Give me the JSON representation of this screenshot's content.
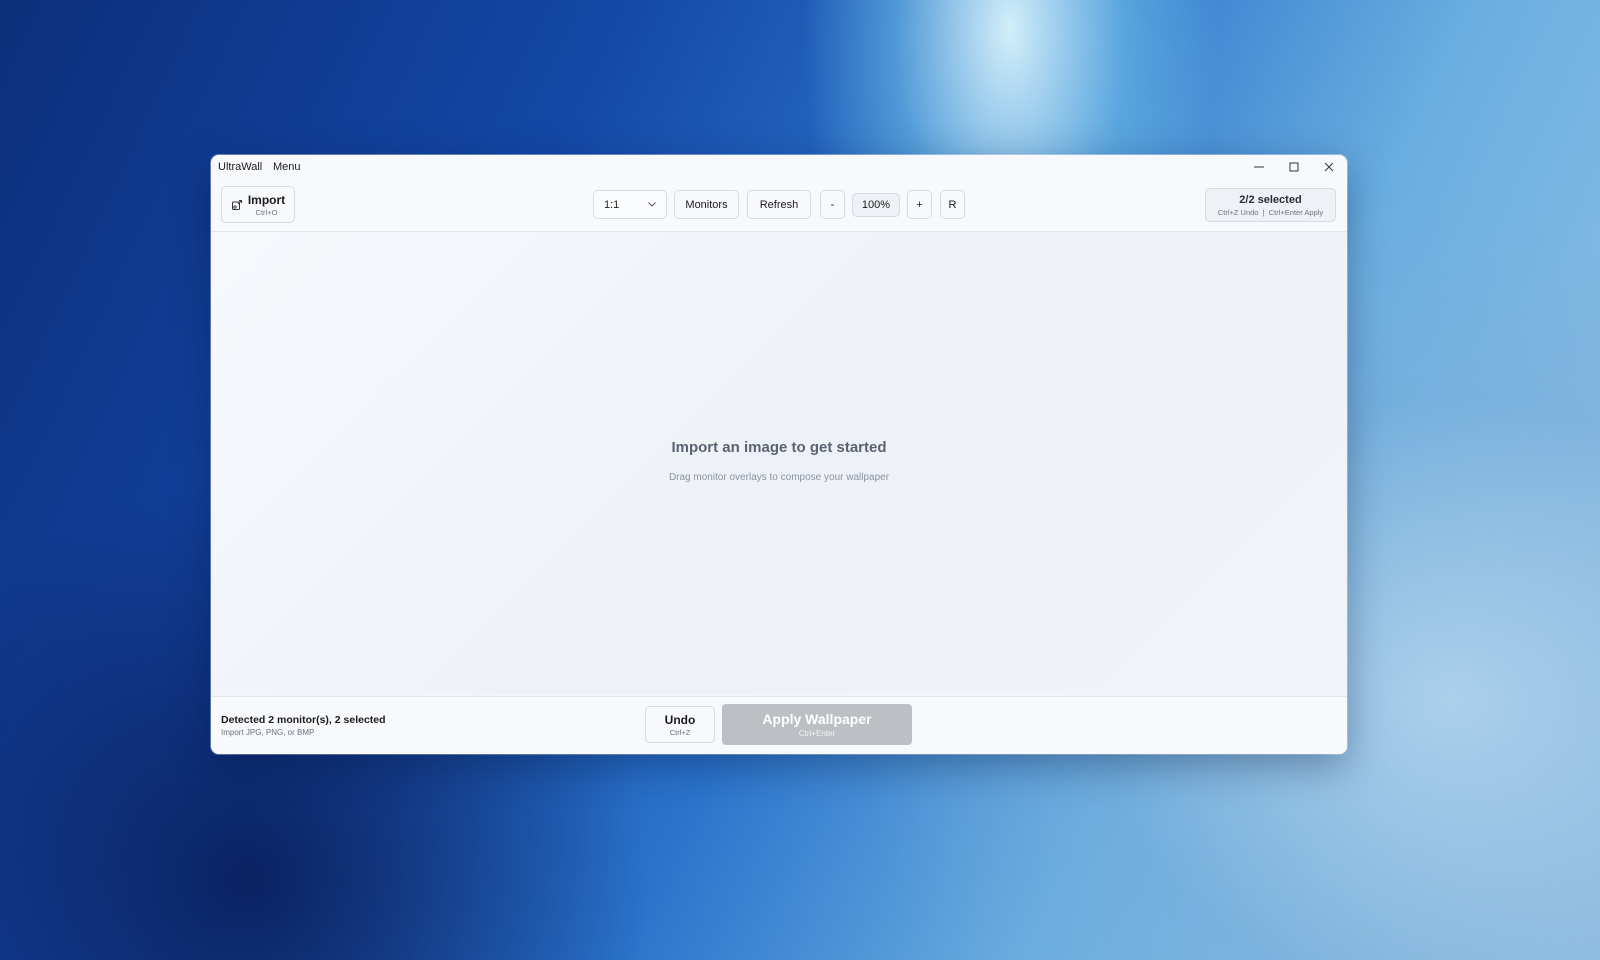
{
  "window": {
    "app_title": "UltraWall",
    "menu_label": "Menu"
  },
  "toolbar": {
    "import_label": "Import",
    "import_shortcut": "Ctrl+O",
    "aspect_value": "1:1",
    "monitors_label": "Monitors",
    "refresh_label": "Refresh",
    "zoom_out_label": "-",
    "zoom_value": "100%",
    "zoom_in_label": "+",
    "reset_label": "R",
    "selection_label": "2/2 selected",
    "selection_hint": "Ctrl+Z Undo  |  Ctrl+Enter Apply"
  },
  "canvas": {
    "empty_title": "Import an image to get started",
    "empty_subtitle": "Drag monitor overlays to compose your wallpaper"
  },
  "status": {
    "detected_text": "Detected 2 monitor(s), 2 selected",
    "formats_text": "Import JPG, PNG, or BMP"
  },
  "actions": {
    "undo_label": "Undo",
    "undo_shortcut": "Ctrl+Z",
    "apply_label": "Apply Wallpaper",
    "apply_shortcut": "Ctrl+Enter"
  },
  "icons": {
    "import": "image-import-icon",
    "dropdown": "chevron-down-icon",
    "minimize": "minimize-icon",
    "maximize": "maximize-icon",
    "close": "close-icon"
  },
  "colors": {
    "apply_disabled": "#bcbfc4",
    "window_bg": "#f3f6fb"
  }
}
